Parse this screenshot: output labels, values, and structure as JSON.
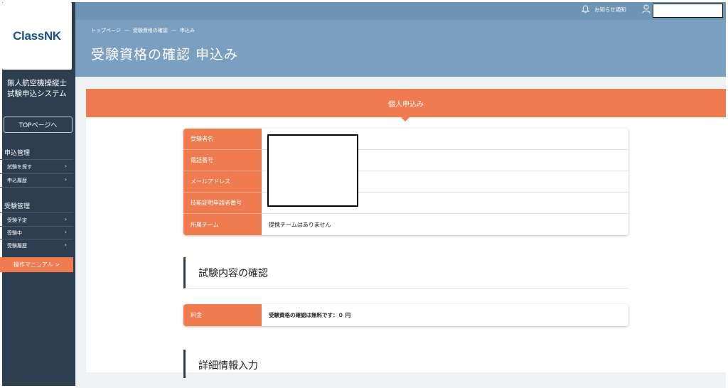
{
  "sidebar": {
    "logo": "ClassNK",
    "system_title": "無人航空機操縦士試験申込システム",
    "top_button": "TOPページへ",
    "groups": [
      {
        "title": "申込管理",
        "items": [
          "試験を探す",
          "申込履歴"
        ]
      },
      {
        "title": "受験管理",
        "items": [
          "受験予定",
          "受験中",
          "受験履歴"
        ]
      }
    ],
    "manual_button": "操作マニュアル >"
  },
  "header": {
    "notice": "お知らせ通知",
    "icons": {
      "notice": "bell-icon",
      "user": "user-icon"
    }
  },
  "hero": {
    "breadcrumb": [
      "トップページ",
      "―",
      "受験資格の確認",
      "―",
      "申込み"
    ],
    "title": "受験資格の確認 申込み"
  },
  "banner": {
    "title": "個人申込み"
  },
  "applicant": {
    "rows": [
      {
        "label": "受験者名",
        "value": ""
      },
      {
        "label": "電話番号",
        "value": ""
      },
      {
        "label": "メールアドレス",
        "value": ""
      },
      {
        "label": "技能証明申請者番号",
        "value": ""
      },
      {
        "label": "所属チーム",
        "value": "提携チームはありません"
      }
    ]
  },
  "exam_section": {
    "title": "試験内容の確認"
  },
  "fee": {
    "label": "料金",
    "value": "受験資格の確認は無料です：０ 円"
  },
  "detail_section": {
    "title": "詳細情報入力"
  },
  "colors": {
    "sidebar": "#2d3e50",
    "header": "#7b9fc0",
    "accent": "#f07b4f"
  }
}
